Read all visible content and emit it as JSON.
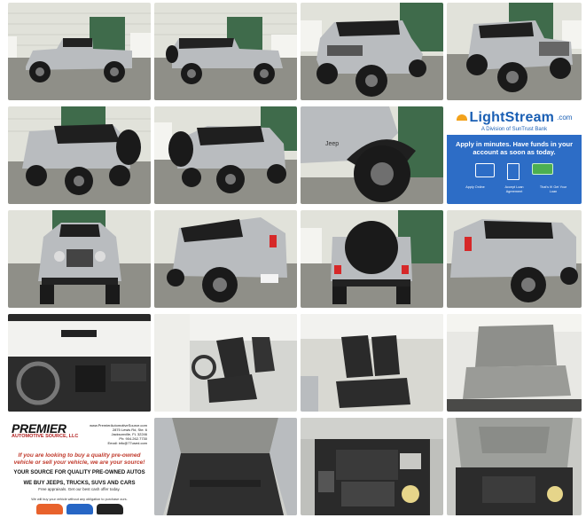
{
  "gallery": {
    "tiles": [
      {
        "name": "jeep-side-left-tile"
      },
      {
        "name": "jeep-side-right-tile"
      },
      {
        "name": "jeep-front-three-quarter-tile"
      },
      {
        "name": "jeep-front-right-tile"
      },
      {
        "name": "jeep-rear-left-tile"
      },
      {
        "name": "jeep-rear-right-tile"
      },
      {
        "name": "jeep-fender-detail-tile"
      },
      {
        "name": "lightstream-ad-tile"
      },
      {
        "name": "jeep-front-tile"
      },
      {
        "name": "jeep-rear-corner-left-tile"
      },
      {
        "name": "jeep-rear-tile"
      },
      {
        "name": "jeep-rear-corner-right-tile"
      },
      {
        "name": "jeep-dashboard-tile"
      },
      {
        "name": "jeep-front-seats-left-tile"
      },
      {
        "name": "jeep-front-seats-right-tile"
      },
      {
        "name": "jeep-rear-seat-tile"
      },
      {
        "name": "premier-ad-tile"
      },
      {
        "name": "jeep-cargo-area-tile"
      },
      {
        "name": "jeep-engine-bay-tile"
      },
      {
        "name": "jeep-engine-bay-open-hood-tile"
      }
    ]
  },
  "lightstream": {
    "logo": "LightStream",
    "logo_suffix": ".com",
    "tagline": "A Division of SunTrust Bank",
    "headline": "Apply in minutes. Have funds in your account as soon as today.",
    "steps": [
      "Apply Online",
      "Accept Loan Agreement",
      "That's It! Get Your Loan"
    ]
  },
  "premier": {
    "logo": "PREMIER",
    "logo_sub": "AUTOMOTIVE SOURCE, LLC",
    "address": [
      "www.PremierAutomotiveSource.com",
      "2875 Lewis Rd, Ste. 6",
      "Jacksonville, FL 32246",
      "Ph: 904.262.7730",
      "Email: info@77used.com"
    ],
    "line1": "If you are looking to buy a quality pre-owned vehicle or sell your vehicle, we are your source!",
    "line2": "YOUR SOURCE FOR QUALITY PRE-OWNED AUTOS",
    "line3": "WE BUY JEEPS, TRUCKS, SUVS AND CARS",
    "line4": "Free appraisals. Get our best cash offer today.",
    "line5": "We will buy your vehicle without any obligation to purchase ours."
  },
  "colors": {
    "jeep_silver": "#b9bcbf",
    "building_wall": "#e3e3dc",
    "door_green": "#3f6b4b",
    "asphalt": "#8f8f88",
    "lightstream_blue": "#2d6dc6",
    "premier_red": "#c0392b"
  }
}
